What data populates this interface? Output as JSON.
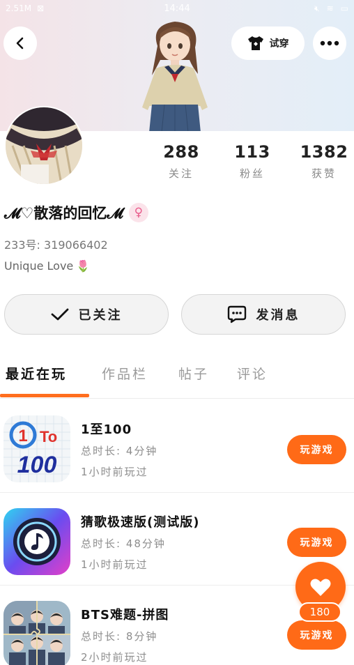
{
  "status_bar": {
    "network_speed": "2.51M",
    "time": "14:44"
  },
  "header": {
    "tryon_label": "试穿"
  },
  "profile": {
    "stats": [
      {
        "value": "288",
        "label": "关注"
      },
      {
        "value": "113",
        "label": "粉丝"
      },
      {
        "value": "1382",
        "label": "获赞"
      }
    ],
    "username": "𝓜♡散落的回忆𝓜",
    "gender_symbol": "♀",
    "uid": "233号: 319066402",
    "bio": "Unique Love",
    "bio_emoji": "🌷"
  },
  "actions": {
    "follow_label": "已关注",
    "message_label": "发消息"
  },
  "tabs": [
    {
      "label": "最近在玩",
      "active": true
    },
    {
      "label": "作品栏",
      "active": false
    },
    {
      "label": "帖子",
      "active": false
    },
    {
      "label": "评论",
      "active": false
    }
  ],
  "games": [
    {
      "title": "1至100",
      "playtime": "总时长: 4分钟",
      "last_played": "1小时前玩过",
      "button": "玩游戏",
      "icon": "1to100-icon"
    },
    {
      "title": "猜歌极速版(测试版)",
      "playtime": "总时长: 48分钟",
      "last_played": "1小时前玩过",
      "button": "玩游戏",
      "icon": "music-note-icon"
    },
    {
      "title": "BTS难题-拼图",
      "playtime": "总时长: 8分钟",
      "last_played": "2小时前玩过",
      "button": "玩游戏",
      "icon": "puzzle-icon"
    }
  ],
  "like_fab": {
    "count": "180"
  },
  "colors": {
    "accent": "#ff6a17",
    "tab_underline": "#ff6e1e"
  }
}
